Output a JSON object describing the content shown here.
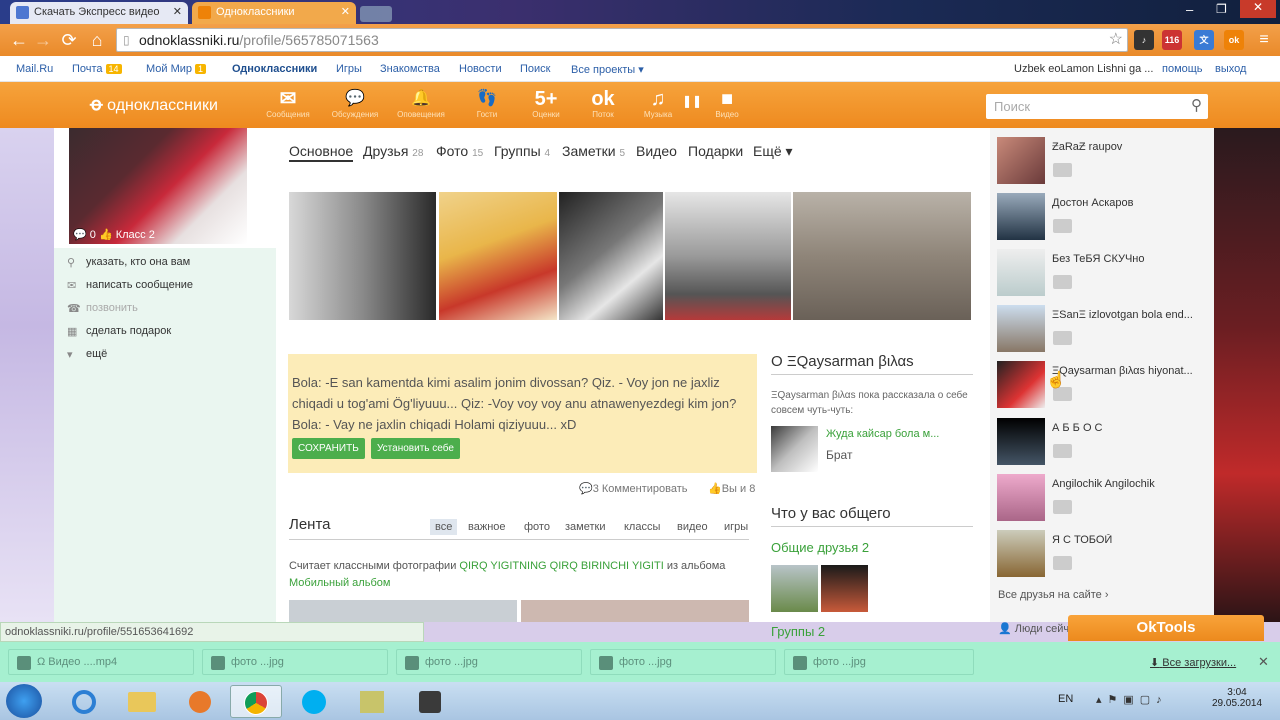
{
  "browser": {
    "tabs": [
      {
        "title": "Скачать Экспресс видео"
      },
      {
        "title": "Одноклассники"
      }
    ],
    "url_host": "odnoklassniki.ru",
    "url_path": "/profile/565785071563",
    "ext_badge": "116"
  },
  "mailru_bar": {
    "links": [
      "Mail.Ru",
      "Почта",
      "Мой Мир",
      "Одноклассники",
      "Игры",
      "Знакомства",
      "Новости",
      "Поиск",
      "Все проекты ▾"
    ],
    "mail_count": "14",
    "mir_count": "1",
    "user": "Uzbek eoLamon Lishni ga ...",
    "help": "помощь",
    "logout": "выход"
  },
  "header": {
    "logo": "одноклассники",
    "icons": [
      {
        "name": "Сообщения",
        "glyph": "✉"
      },
      {
        "name": "Обсуждения",
        "glyph": "💬"
      },
      {
        "name": "Оповещения",
        "glyph": "🔔"
      },
      {
        "name": "Гости",
        "glyph": "👣"
      },
      {
        "name": "Оценки",
        "glyph": "5+"
      },
      {
        "name": "Поток",
        "glyph": "ok"
      },
      {
        "name": "Музыка",
        "glyph": "♫"
      },
      {
        "name": "Видео",
        "glyph": "■"
      }
    ],
    "search_placeholder": "Поиск"
  },
  "profile": {
    "comments": "0",
    "class": "Класс 2",
    "actions": [
      "указать, кто она вам",
      "написать сообщение",
      "позвонить",
      "сделать подарок",
      "ещё"
    ]
  },
  "menu": [
    {
      "label": "Основное",
      "count": ""
    },
    {
      "label": "Друзья",
      "count": "28"
    },
    {
      "label": "Фото",
      "count": "15"
    },
    {
      "label": "Группы",
      "count": "4"
    },
    {
      "label": "Заметки",
      "count": "5"
    },
    {
      "label": "Видео",
      "count": ""
    },
    {
      "label": "Подарки",
      "count": ""
    },
    {
      "label": "Ещё ▾",
      "count": ""
    }
  ],
  "status": {
    "text": "Bola: -E san kamentda kimi asalim jonim divossan? Qiz. - Voy jon ne jaxliz chiqadi u tog'ami Ög'liyuuu...    Qiz: -Voy voy voy anu atnawenyezdegi kim jon? Bola: - Vay ne jaxlin chiqadi Holami qiziyuuu... xD",
    "save": "СОХРАНИТЬ",
    "set": "Установить себе",
    "comments": "3 Комментировать",
    "likes": "Вы и 8"
  },
  "feed": {
    "title": "Лента",
    "tabs": [
      "все",
      "важное",
      "фото",
      "заметки",
      "классы",
      "видео",
      "игры"
    ],
    "entry_prefix": "Считает классными фотографии",
    "entry_user": "QIRQ YIGITNING QIRQ BIRINCHI YIGITI",
    "entry_mid": "из альбома",
    "entry_album": "Мобильный альбом"
  },
  "about": {
    "title": "О ΞQaysarman βιλαѕ",
    "text": "ΞQaysarman βιλαѕ пока рассказала о себе совсем чуть-чуть:",
    "relative_name": "Жуда кайсар бола м...",
    "relative_role": "Брат"
  },
  "common": {
    "title": "Что у вас общего",
    "friends": "Общие друзья 2",
    "groups": "Группы 2"
  },
  "friends": {
    "list": [
      "ƵaRaƵ raupov",
      "Достон Аскаров",
      "Без ТеБЯ СКУЧно",
      "ΞSanΞ izlovotgan bola end...",
      "ΞQaysarman βιλαѕ hiyonat...",
      "А Б Б О С",
      "Angilochik Angilochik",
      "Я С ТОБОЙ"
    ],
    "all": "Все друзья на сайте",
    "people": "Люди сейч"
  },
  "statusbar_url": "odnoklassniki.ru/profile/551653641692",
  "oktools": "OkTools",
  "downloads": {
    "items": [
      "Ω Видео ....mp4",
      "фото ...jpg",
      "фото ...jpg",
      "фото ...jpg",
      "фото ...jpg"
    ],
    "all": "Все загрузки..."
  },
  "taskbar": {
    "lang": "EN",
    "time": "3:04",
    "date": "29.05.2014"
  }
}
